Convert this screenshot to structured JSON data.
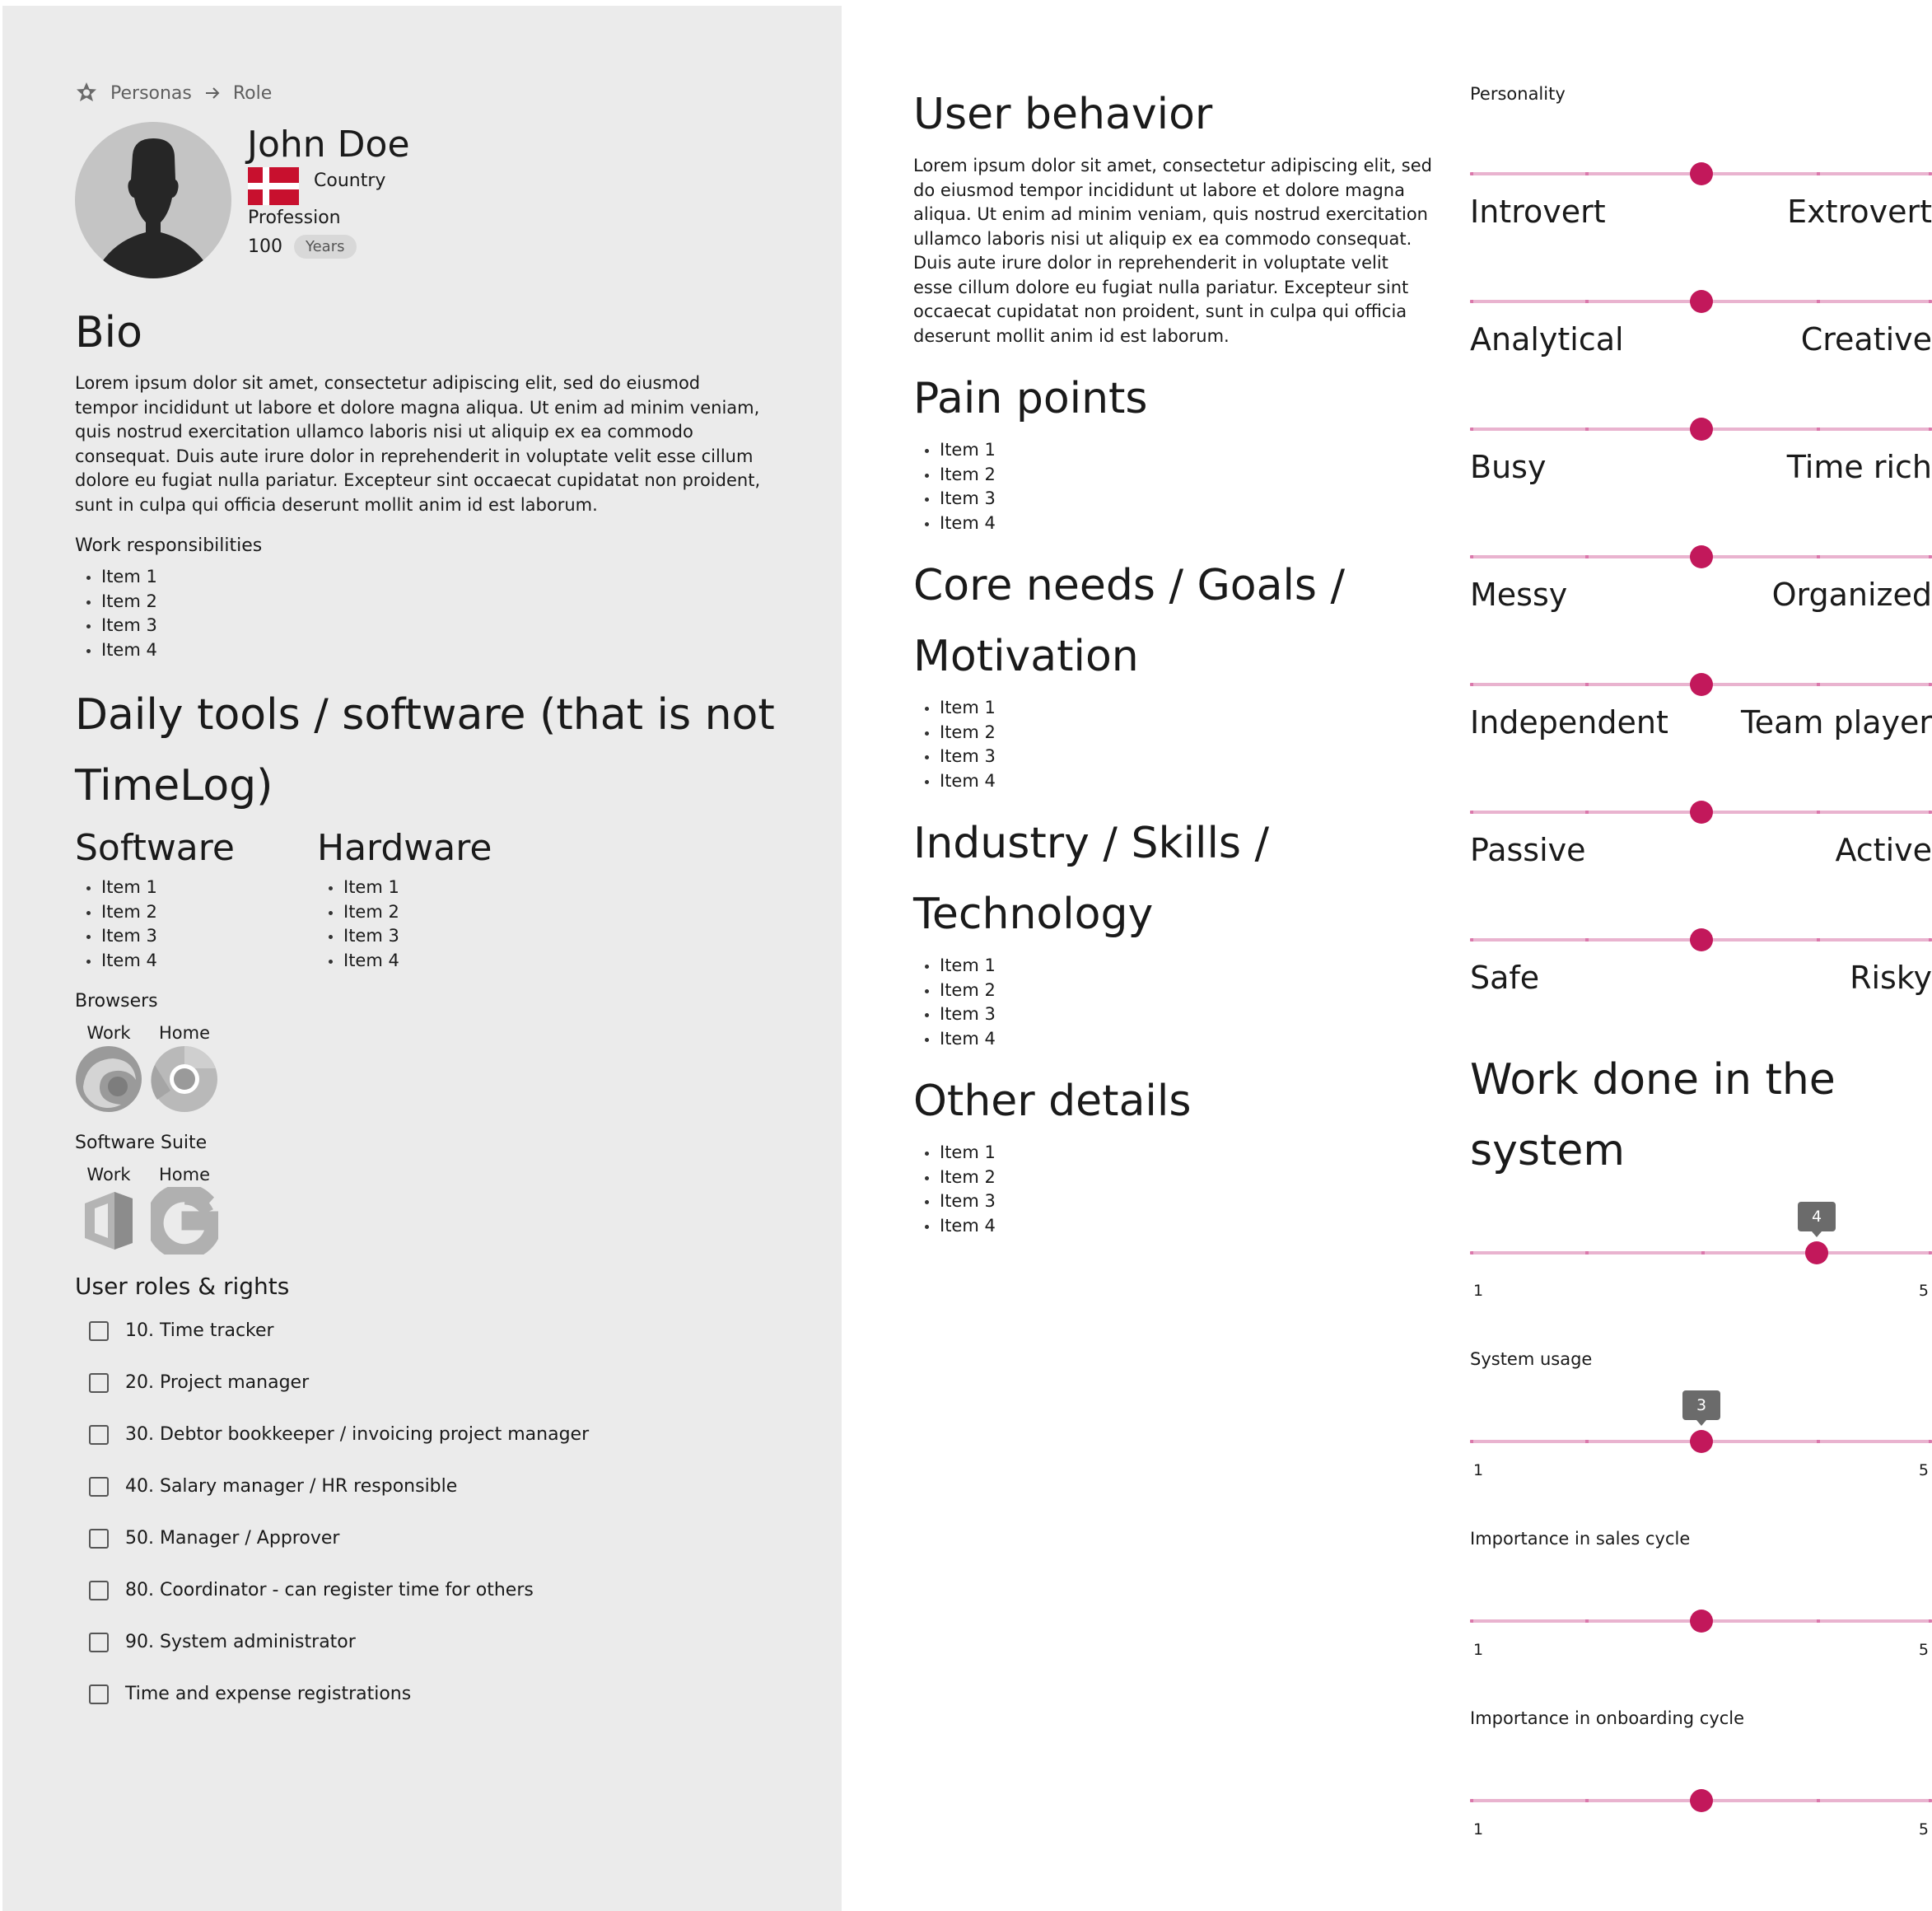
{
  "breadcrumb": {
    "root": "Personas",
    "current": "Role"
  },
  "profile": {
    "name": "John Doe",
    "country": "Country",
    "profession": "Profession",
    "age_value": "100",
    "age_unit": "Years",
    "flag_colors": {
      "red": "#c8102e",
      "white": "#ffffff"
    }
  },
  "bio": {
    "title": "Bio",
    "text": "Lorem ipsum dolor sit amet, consectetur adipiscing elit, sed do eiusmod tempor incididunt ut labore et dolore magna aliqua. Ut enim ad minim veniam, quis nostrud exercitation ullamco laboris nisi ut aliquip ex ea commodo consequat. Duis aute irure dolor in reprehenderit in voluptate velit esse cillum dolore eu fugiat nulla pariatur. Excepteur sint occaecat cupidatat non proident, sunt in culpa qui officia deserunt mollit anim id est laborum.",
    "work_resp_title": "Work responsibilities",
    "work_resp_items": [
      "Item 1",
      "Item 2",
      "Item 3",
      "Item 4"
    ]
  },
  "tools": {
    "title": "Daily tools / software (that is not TimeLog)",
    "software_title": "Software",
    "software_items": [
      "Item 1",
      "Item 2",
      "Item 3",
      "Item 4"
    ],
    "hardware_title": "Hardware",
    "hardware_items": [
      "Item 1",
      "Item 2",
      "Item 3",
      "Item 4"
    ],
    "browsers_title": "Browsers",
    "browsers": [
      {
        "label": "Work",
        "icon": "edge-icon"
      },
      {
        "label": "Home",
        "icon": "chrome-icon"
      }
    ],
    "suite_title": "Software Suite",
    "suites": [
      {
        "label": "Work",
        "icon": "office-icon"
      },
      {
        "label": "Home",
        "icon": "google-icon"
      }
    ]
  },
  "roles": {
    "title": "User roles & rights",
    "items": [
      "10. Time tracker",
      "20. Project manager",
      "30. Debtor bookkeeper / invoicing project manager",
      "40. Salary manager / HR responsible",
      "50. Manager / Approver",
      "80. Coordinator - can register time for others",
      "90. System administrator",
      "Time and expense registrations"
    ]
  },
  "behavior": {
    "title": "User behavior",
    "text": "Lorem ipsum dolor sit amet, consectetur adipiscing elit, sed do eiusmod tempor incididunt ut labore et dolore magna aliqua. Ut enim ad minim veniam, quis nostrud exercitation ullamco laboris nisi ut aliquip ex ea commodo consequat. Duis aute irure dolor in reprehenderit in voluptate velit esse cillum dolore eu fugiat nulla pariatur. Excepteur sint occaecat cupidatat non proident, sunt in culpa qui officia deserunt mollit anim id est laborum."
  },
  "pain_points": {
    "title": "Pain points",
    "items": [
      "Item 1",
      "Item 2",
      "Item 3",
      "Item 4"
    ]
  },
  "core_needs": {
    "title": "Core needs / Goals / Motivation",
    "items": [
      "Item 1",
      "Item 2",
      "Item 3",
      "Item 4"
    ]
  },
  "industry": {
    "title": "Industry / Skills / Technology",
    "items": [
      "Item 1",
      "Item 2",
      "Item 3",
      "Item 4"
    ]
  },
  "other": {
    "title": "Other details",
    "items": [
      "Item 1",
      "Item 2",
      "Item 3",
      "Item 4"
    ]
  },
  "personality": {
    "title": "Personality",
    "accent": "#c2185b",
    "track_color": "#e9b3cf",
    "scales": [
      {
        "left": "Introvert",
        "right": "Extrovert",
        "value": 0.5
      },
      {
        "left": "Analytical",
        "right": "Creative",
        "value": 0.5
      },
      {
        "left": "Busy",
        "right": "Time rich",
        "value": 0.5
      },
      {
        "left": "Messy",
        "right": "Organized",
        "value": 0.5
      },
      {
        "left": "Independent",
        "right": "Team player",
        "value": 0.5
      },
      {
        "left": "Passive",
        "right": "Active",
        "value": 0.5
      },
      {
        "left": "Safe",
        "right": "Risky",
        "value": 0.5
      }
    ]
  },
  "work_done": {
    "title": "Work done in the system",
    "value": 4,
    "tooltip": "4",
    "min": "1",
    "max": "5"
  },
  "system_usage": {
    "title": "System usage",
    "value": 3,
    "tooltip": "3",
    "min": "1",
    "max": "5"
  },
  "sales_cycle": {
    "title": "Importance in sales cycle",
    "value": 3,
    "min": "1",
    "max": "5"
  },
  "onboarding_cycle": {
    "title": "Importance in onboarding cycle",
    "value": 3,
    "min": "1",
    "max": "5"
  }
}
